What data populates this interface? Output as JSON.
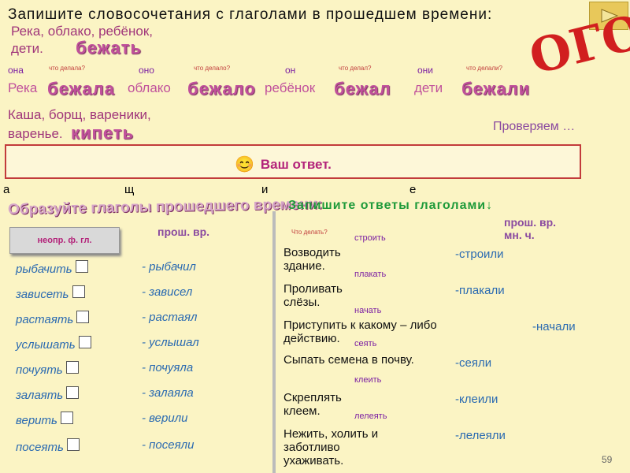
{
  "header": "Запишите словосочетания с глаголами в прошедшем времени:",
  "nouns1": "Река, облако, ребёнок,",
  "nouns1b": "дети.",
  "verb1": "бежать",
  "pron": [
    "она",
    "оно",
    "он",
    "они"
  ],
  "q": [
    "что делала?",
    "что делало?",
    "что делал?",
    "что делали?"
  ],
  "nouns": [
    "Река",
    "облако",
    "ребёнок",
    "дети"
  ],
  "forms": [
    "бежала",
    "бежало",
    "бежал",
    "бежали"
  ],
  "nouns2": "Каша, борщ, вареники,",
  "nouns2b": "варенье.",
  "verb2": "кипеть",
  "check": "Проверяем …",
  "answer": "Ваш ответ.",
  "left_frags": [
    "а",
    "щ",
    "и",
    "е"
  ],
  "sec2": "Образуйте глаголы прошедшего времени:",
  "sec3": "Запишите ответы глаголами↓",
  "col_head": "неопр. ф. гл.",
  "past_head": "прош. вр.",
  "ans_head": "прош. вр. мн. ч.",
  "infinitives": [
    "рыбачить",
    "зависеть",
    "растаять",
    "услышать",
    "почуять",
    "залаять",
    "верить",
    "посеять"
  ],
  "past_forms": [
    "- рыбачил",
    "- зависел",
    "- растаял",
    "- услышал",
    "- почуяла",
    "- залаяла",
    "- верили",
    "- посеяли"
  ],
  "tasks": [
    "Возводить здание.",
    "Проливать слёзы.",
    "Приступить к какому – либо действию.",
    "Сыпать семена в почву.",
    "Скреплять клеем.",
    "Нежить, холить и заботливо ухаживать."
  ],
  "task_verbs": [
    "строить",
    "плакать",
    "начать",
    "сеять",
    "клеить",
    "лелеять"
  ],
  "answers": [
    "-строили",
    "-плакали",
    "-начали",
    "-сеяли",
    "-клеили",
    "-лелеяли"
  ],
  "what_did": "Что делать?",
  "page": "59"
}
